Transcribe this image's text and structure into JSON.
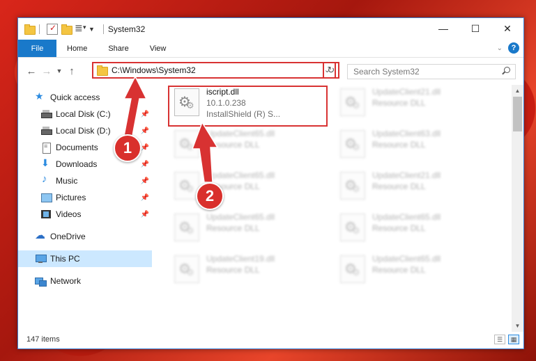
{
  "window": {
    "title": "System32",
    "controls": {
      "minimize": "—",
      "maximize": "☐",
      "close": "✕"
    }
  },
  "ribbon": {
    "tabs": [
      {
        "label": "File"
      },
      {
        "label": "Home"
      },
      {
        "label": "Share"
      },
      {
        "label": "View"
      }
    ],
    "help": "?"
  },
  "address": {
    "path": "C:\\Windows\\System32",
    "search_placeholder": "Search System32"
  },
  "nav": {
    "quick_access": "Quick access",
    "items": [
      {
        "label": "Local Disk (C:)"
      },
      {
        "label": "Local Disk (D:)"
      },
      {
        "label": "Documents"
      },
      {
        "label": "Downloads"
      },
      {
        "label": "Music"
      },
      {
        "label": "Pictures"
      },
      {
        "label": "Videos"
      }
    ],
    "onedrive": "OneDrive",
    "this_pc": "This PC",
    "network": "Network"
  },
  "files": [
    {
      "name": "iscript.dll",
      "line2": "10.1.0.238",
      "line3": "InstallShield (R) S..."
    },
    {
      "name": "UpdateClient21.dll",
      "line2": "Resource DLL"
    },
    {
      "name": "UpdateClient65.dll",
      "line2": "Resource DLL"
    },
    {
      "name": "UpdateClient63.dll",
      "line2": "Resource DLL"
    },
    {
      "name": "UpdateClient65.dll",
      "line2": "Resource DLL"
    },
    {
      "name": "UpdateClient21.dll",
      "line2": "Resource DLL"
    },
    {
      "name": "UpdateClient65.dll",
      "line2": "Resource DLL"
    },
    {
      "name": "UpdateClient65.dll",
      "line2": "Resource DLL"
    },
    {
      "name": "UpdateClient19.dll",
      "line2": "Resource DLL"
    },
    {
      "name": "UpdateClient65.dll",
      "line2": "Resource DLL"
    }
  ],
  "status": {
    "count": "147 items"
  },
  "annotations": {
    "step1": "1",
    "step2": "2",
    "color": "#d83232"
  }
}
